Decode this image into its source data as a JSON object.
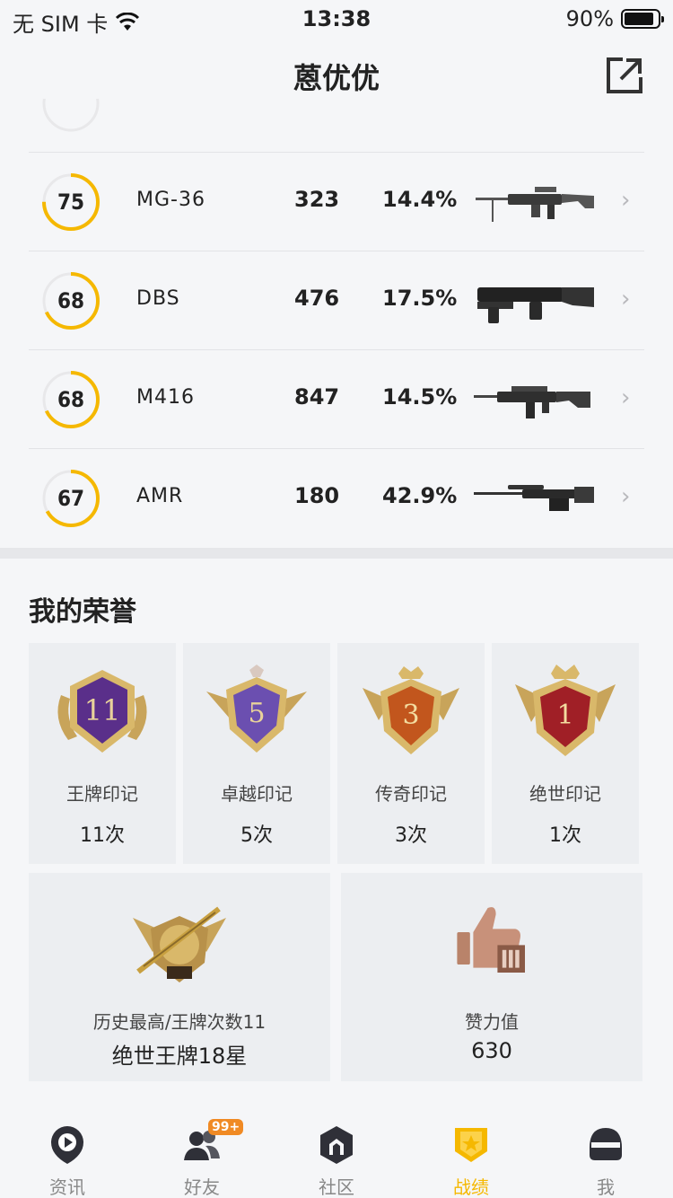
{
  "status_bar": {
    "carrier": "无 SIM 卡",
    "time": "13:38",
    "battery": "90%"
  },
  "nav": {
    "title": "蒽优优",
    "share_icon": "share-external-icon"
  },
  "weapons": [
    {
      "score": "75",
      "name": "MG-36",
      "kills": "323",
      "rate": "14.4%",
      "score_fraction": 0.75,
      "icon": "lmg-icon"
    },
    {
      "score": "68",
      "name": "DBS",
      "kills": "476",
      "rate": "17.5%",
      "score_fraction": 0.68,
      "icon": "shotgun-icon"
    },
    {
      "score": "68",
      "name": "M416",
      "kills": "847",
      "rate": "14.5%",
      "score_fraction": 0.68,
      "icon": "rifle-icon"
    },
    {
      "score": "67",
      "name": "AMR",
      "kills": "180",
      "rate": "42.9%",
      "score_fraction": 0.67,
      "icon": "sniper-icon"
    }
  ],
  "honor": {
    "title": "我的荣誉",
    "badges": [
      {
        "number": "11",
        "name": "王牌印记",
        "count": "11次",
        "color": "#5a2f8a"
      },
      {
        "number": "5",
        "name": "卓越印记",
        "count": "5次",
        "color": "#6b4fb0"
      },
      {
        "number": "3",
        "name": "传奇印记",
        "count": "3次",
        "color": "#c2561d"
      },
      {
        "number": "1",
        "name": "绝世印记",
        "count": "1次",
        "color": "#a01f26"
      }
    ],
    "highest": {
      "label": "历史最高/王牌次数11",
      "value": "绝世王牌18星"
    },
    "likes": {
      "label": "赞力值",
      "value": "630"
    }
  },
  "tabs": [
    {
      "label": "资讯",
      "icon": "news-play-icon",
      "active": false
    },
    {
      "label": "好友",
      "icon": "friends-icon",
      "active": false,
      "badge": "99+"
    },
    {
      "label": "社区",
      "icon": "community-icon",
      "active": false
    },
    {
      "label": "战绩",
      "icon": "record-badge-icon",
      "active": true
    },
    {
      "label": "我",
      "icon": "helmet-icon",
      "active": false
    }
  ],
  "colors": {
    "accent": "#f5b800",
    "ring_track": "#e8e8ea",
    "badge_orange": "#f08a24"
  }
}
